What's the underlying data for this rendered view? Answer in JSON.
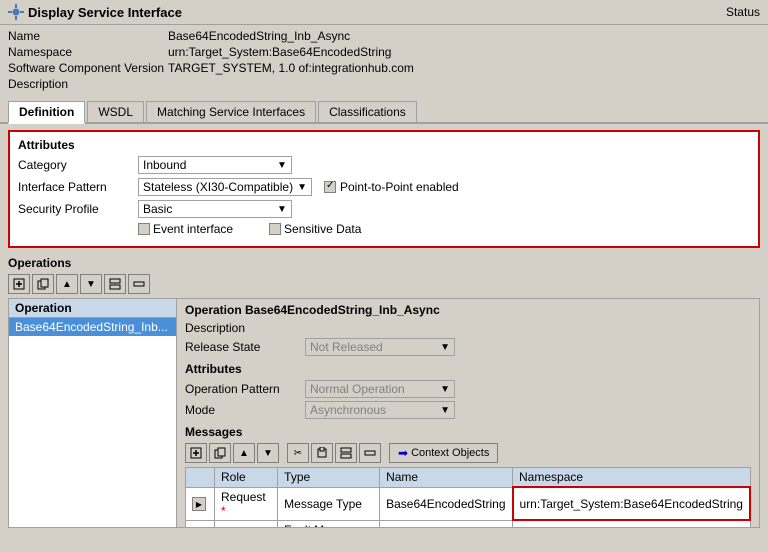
{
  "header": {
    "title": "Display Service Interface",
    "status_label": "Status",
    "icon": "gear"
  },
  "form": {
    "name_label": "Name",
    "name_value": "Base64EncodedString_Inb_Async",
    "namespace_label": "Namespace",
    "namespace_value": "urn:Target_System:Base64EncodedString",
    "sw_component_label": "Software Component Version",
    "sw_component_value": "TARGET_SYSTEM, 1.0 of:integrationhub.com",
    "description_label": "Description",
    "description_value": ""
  },
  "tabs": [
    {
      "label": "Definition",
      "active": true
    },
    {
      "label": "WSDL",
      "active": false
    },
    {
      "label": "Matching Service Interfaces",
      "active": false
    },
    {
      "label": "Classifications",
      "active": false
    }
  ],
  "attributes": {
    "title": "Attributes",
    "category_label": "Category",
    "category_value": "Inbound",
    "interface_pattern_label": "Interface Pattern",
    "interface_pattern_value": "Stateless (XI30-Compatible)",
    "point_to_point_label": "Point-to-Point enabled",
    "security_profile_label": "Security Profile",
    "security_profile_value": "Basic",
    "event_interface_label": "Event interface",
    "sensitive_data_label": "Sensitive Data"
  },
  "operations": {
    "title": "Operations",
    "list_header": "Operation",
    "list_item": "Base64EncodedString_Inb...",
    "detail_title": "Operation Base64EncodedString_Inb_Async",
    "description_label": "Description",
    "description_value": "",
    "release_state_label": "Release State",
    "release_state_value": "Not Released",
    "attributes_title": "Attributes",
    "operation_pattern_label": "Operation Pattern",
    "operation_pattern_value": "Normal Operation",
    "mode_label": "Mode",
    "mode_value": "Asynchronous",
    "messages_title": "Messages",
    "context_objects_label": "Context Objects",
    "table": {
      "col_role": "Role",
      "col_type": "Type",
      "col_name": "Name",
      "col_namespace": "Namespace",
      "rows": [
        {
          "role": "Request",
          "required": true,
          "type": "Message Type",
          "name": "Base64EncodedString",
          "namespace": "urn:Target_System:Base64EncodedString",
          "highlight": true
        },
        {
          "role": "Fault",
          "required": false,
          "type": "Fault Message Type",
          "name": "",
          "namespace": "",
          "highlight": false
        }
      ]
    }
  },
  "toolbar": {
    "buttons": [
      "new",
      "copy",
      "up",
      "down",
      "expand",
      "collapse"
    ]
  }
}
